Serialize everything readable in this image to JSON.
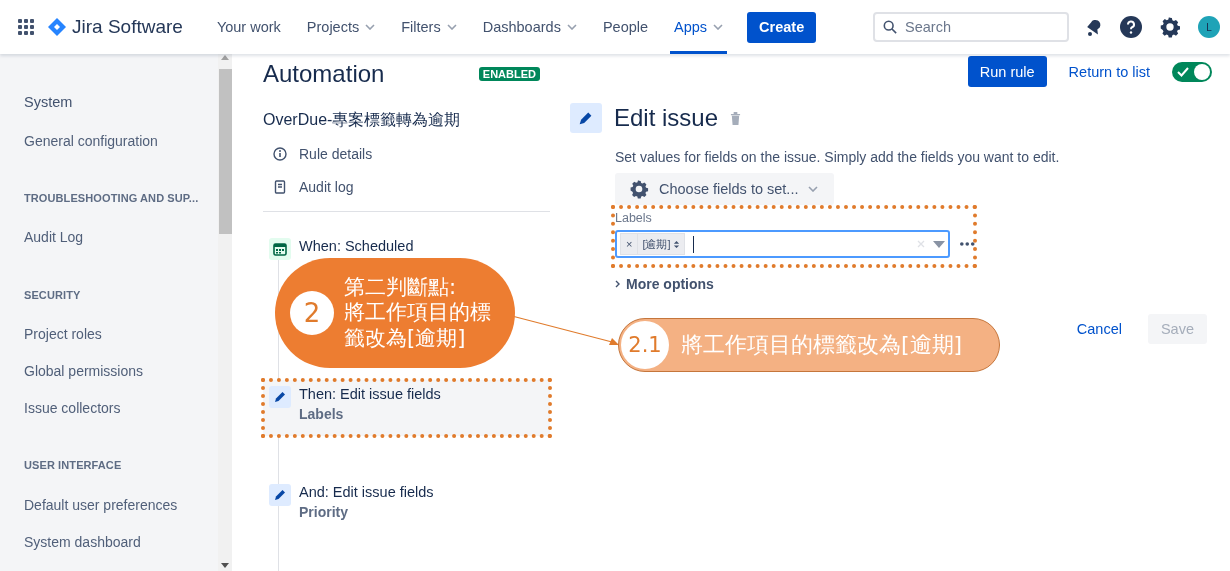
{
  "top_nav": {
    "product": "Jira Software",
    "items": [
      {
        "label": "Your work",
        "dropdown": false,
        "selected": false
      },
      {
        "label": "Projects",
        "dropdown": true,
        "selected": false
      },
      {
        "label": "Filters",
        "dropdown": true,
        "selected": false
      },
      {
        "label": "Dashboards",
        "dropdown": true,
        "selected": false
      },
      {
        "label": "People",
        "dropdown": false,
        "selected": false
      },
      {
        "label": "Apps",
        "dropdown": true,
        "selected": true
      }
    ],
    "create": "Create",
    "search": {
      "placeholder": "Search"
    },
    "avatar": "L"
  },
  "sidebar": {
    "items": [
      {
        "kind": "title",
        "label": "System"
      },
      {
        "kind": "link",
        "label": "General configuration"
      },
      {
        "kind": "header",
        "label": "TROUBLESHOOTING AND SUP..."
      },
      {
        "kind": "link",
        "label": "Audit Log"
      },
      {
        "kind": "header",
        "label": "SECURITY"
      },
      {
        "kind": "link",
        "label": "Project roles"
      },
      {
        "kind": "link",
        "label": "Global permissions"
      },
      {
        "kind": "link",
        "label": "Issue collectors"
      },
      {
        "kind": "header",
        "label": "USER INTERFACE"
      },
      {
        "kind": "link",
        "label": "Default user preferences"
      },
      {
        "kind": "link",
        "label": "System dashboard"
      }
    ]
  },
  "rule": {
    "title": "Automation",
    "status": "ENABLED",
    "name": "OverDue-專案標籤轉為逾期",
    "links": [
      {
        "kind": "info",
        "label": "Rule details"
      },
      {
        "kind": "log",
        "label": "Audit log"
      }
    ],
    "steps": [
      {
        "kind": "trigger",
        "title": "When: Scheduled",
        "highlighted": false
      },
      {
        "kind": "action",
        "title": "Then: Edit issue fields",
        "detail": "Labels",
        "highlighted": true
      },
      {
        "kind": "action",
        "title": "And: Edit issue fields",
        "detail": "Priority",
        "highlighted": false
      }
    ]
  },
  "toolbar": {
    "run": "Run rule",
    "return": "Return to list",
    "enabled": true
  },
  "editor": {
    "title": "Edit issue",
    "description": "Set values for fields on the issue. Simply add the fields you want to edit.",
    "choose": "Choose fields to set...",
    "field": {
      "label": "Labels",
      "highlighted": true,
      "tags": [
        {
          "remove": "×",
          "label": "[逾期]"
        }
      ]
    },
    "more": "More options",
    "cancel": "Cancel",
    "save": {
      "label": "Save",
      "disabled": true
    }
  },
  "annotations": [
    {
      "kind": "main",
      "number": "2",
      "text": "第二判斷點:\n將工作項目的標籤改為[逾期]"
    },
    {
      "kind": "sub",
      "number": "2.1",
      "text": "將工作項目的標籤改為[逾期]"
    }
  ]
}
